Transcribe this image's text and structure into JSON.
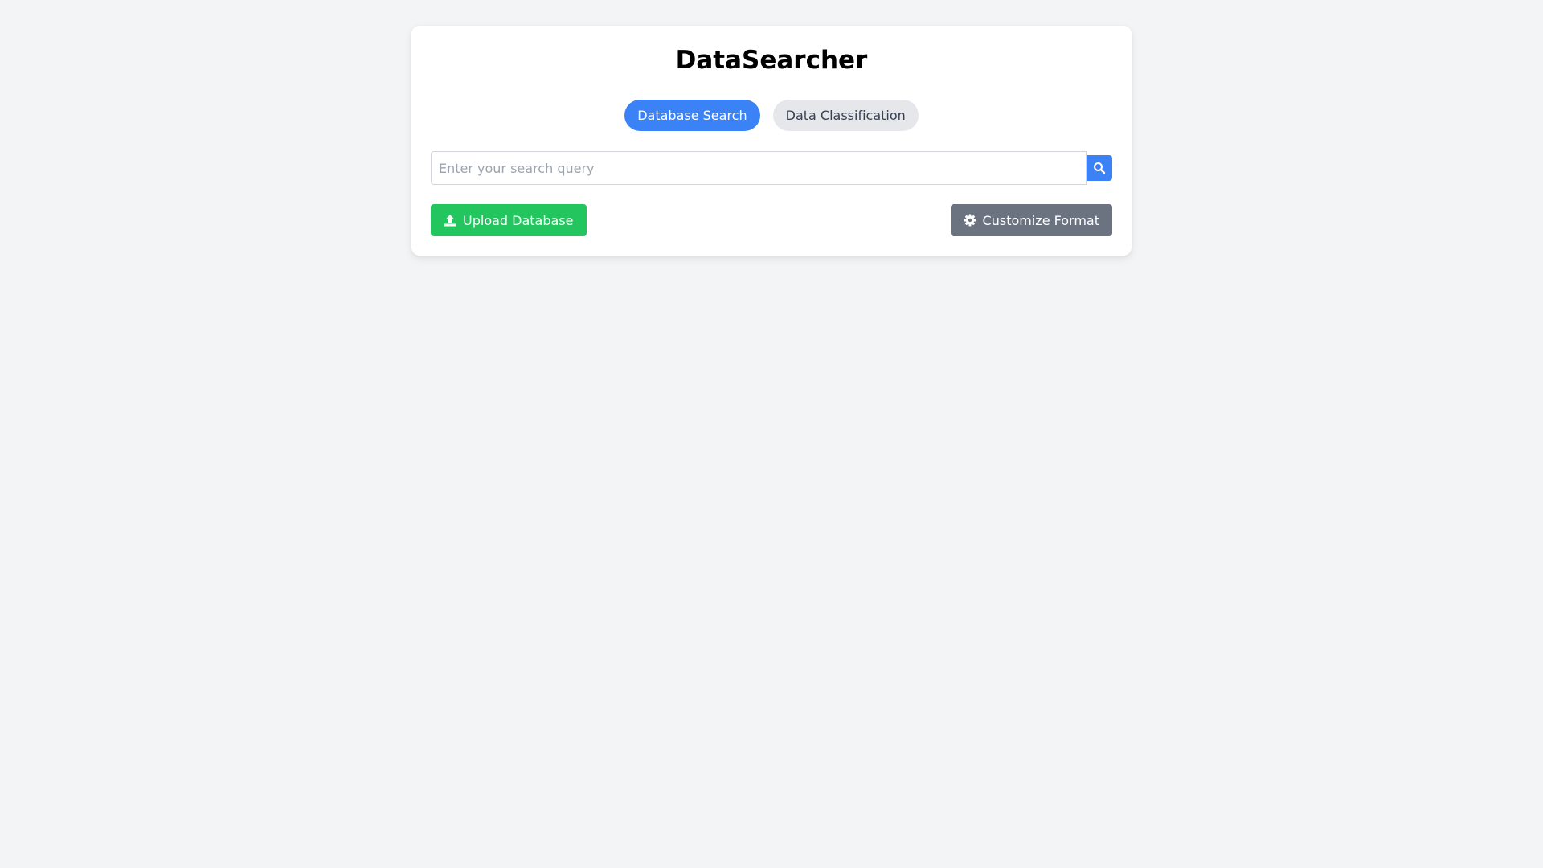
{
  "app": {
    "title": "DataSearcher"
  },
  "tabs": [
    {
      "label": "Database Search",
      "active": true
    },
    {
      "label": "Data Classification",
      "active": false
    }
  ],
  "search": {
    "placeholder": "Enter your search query",
    "value": "",
    "button_icon": "search-icon"
  },
  "actions": {
    "upload_label": "Upload Database",
    "upload_icon": "upload-icon",
    "format_label": "Customize Format",
    "format_icon": "gear-icon"
  },
  "colors": {
    "primary": "#3b82f6",
    "success": "#22c55e",
    "secondary": "#6b7280",
    "tab_inactive": "#e5e7eb",
    "background": "#f3f4f6"
  }
}
